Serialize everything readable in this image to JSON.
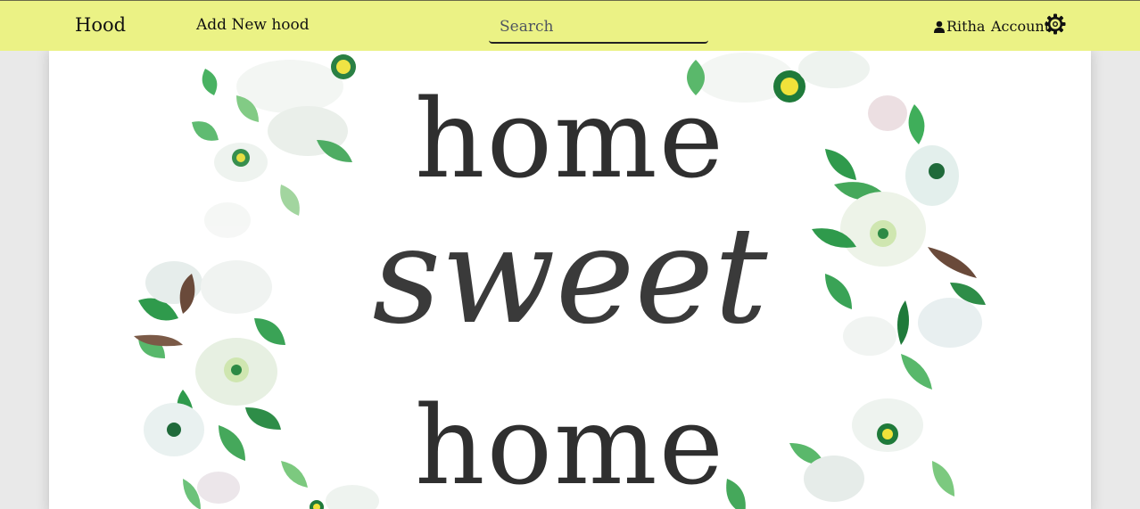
{
  "navbar": {
    "brand": "Hood",
    "add_link": "Add New hood",
    "search_placeholder": "Search",
    "user_name": "Ritha",
    "accounts_label": "Accounts",
    "icons": {
      "user": "user-icon",
      "settings": "gear-icon"
    },
    "background_color": "#ebf285"
  },
  "hero": {
    "line1": "home",
    "line2": "sweet",
    "line3": "home"
  }
}
